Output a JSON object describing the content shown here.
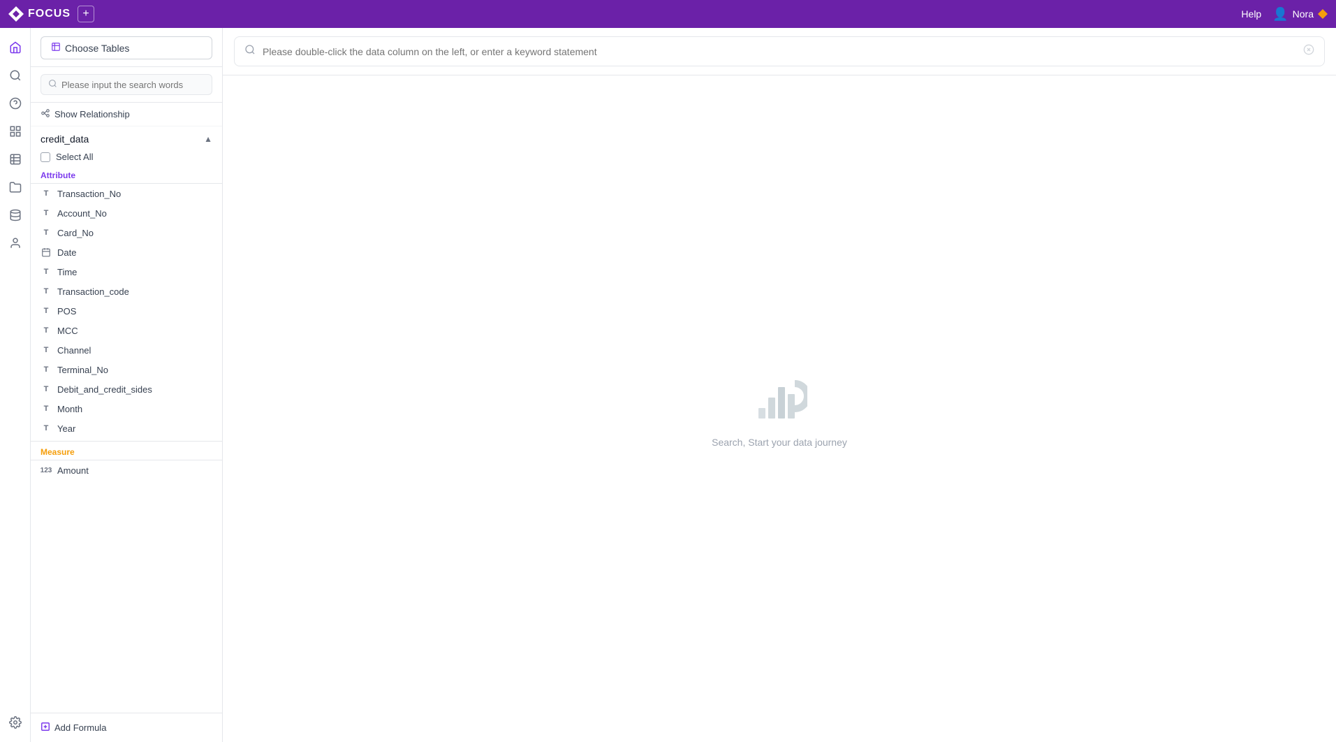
{
  "app": {
    "name": "FOCUS"
  },
  "topnav": {
    "help_label": "Help",
    "user_name": "Nora"
  },
  "sidebar": {
    "choose_tables_label": "Choose Tables",
    "search_placeholder": "Please input the search words",
    "show_relationship_label": "Show Relationship",
    "table_group_name": "credit_data",
    "select_all_label": "Select All",
    "attribute_section_label": "Attribute",
    "measure_section_label": "Measure",
    "fields": [
      {
        "name": "Transaction_No",
        "type": "T"
      },
      {
        "name": "Account_No",
        "type": "T"
      },
      {
        "name": "Card_No",
        "type": "T"
      },
      {
        "name": "Date",
        "type": "CAL"
      },
      {
        "name": "Time",
        "type": "T"
      },
      {
        "name": "Transaction_code",
        "type": "T"
      },
      {
        "name": "POS",
        "type": "T"
      },
      {
        "name": "MCC",
        "type": "T"
      },
      {
        "name": "Channel",
        "type": "T"
      },
      {
        "name": "Terminal_No",
        "type": "T"
      },
      {
        "name": "Debit_and_credit_sides",
        "type": "T"
      },
      {
        "name": "Month",
        "type": "T"
      },
      {
        "name": "Year",
        "type": "T"
      }
    ],
    "measures": [
      {
        "name": "Amount",
        "type": "123"
      }
    ],
    "add_formula_label": "Add Formula"
  },
  "searchbar": {
    "placeholder": "Please double-click the data column on the left, or enter a keyword statement"
  },
  "empty_state": {
    "text": "Search, Start your data journey"
  },
  "iconbar": {
    "items": [
      {
        "name": "home-icon",
        "symbol": "⌂"
      },
      {
        "name": "search-icon",
        "symbol": "⊕"
      },
      {
        "name": "help-icon",
        "symbol": "?"
      },
      {
        "name": "chart-icon",
        "symbol": "≡"
      },
      {
        "name": "grid-icon",
        "symbol": "⊞"
      },
      {
        "name": "folder-icon",
        "symbol": "▭"
      },
      {
        "name": "data-icon",
        "symbol": "⊟"
      },
      {
        "name": "user-icon",
        "symbol": "○"
      },
      {
        "name": "settings-icon",
        "symbol": "⚙"
      }
    ]
  }
}
